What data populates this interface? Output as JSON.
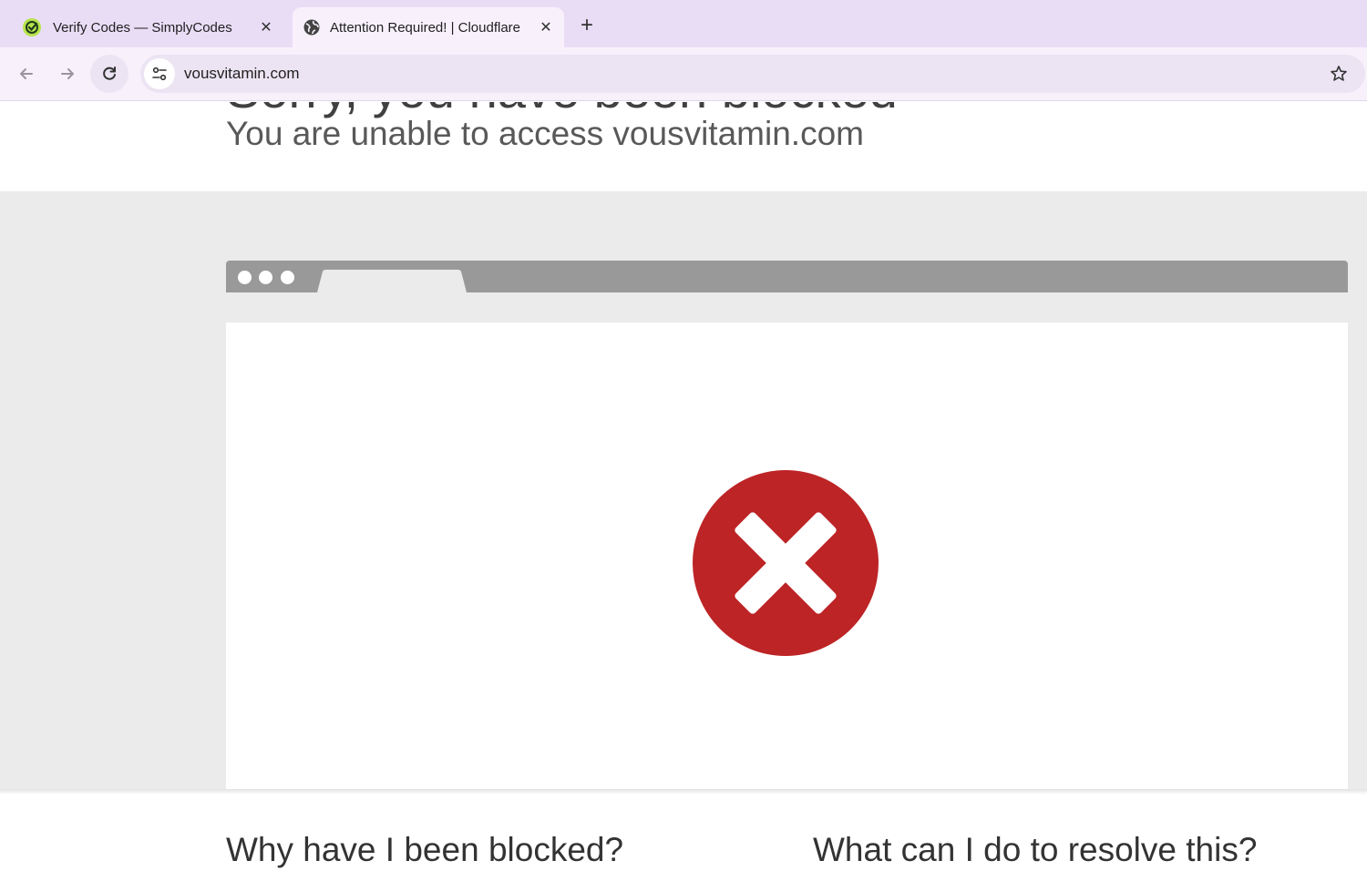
{
  "browser": {
    "tabs": [
      {
        "title": "Verify Codes — SimplyCodes",
        "icon": "simplycodes-favicon",
        "active": false
      },
      {
        "title": "Attention Required! | Cloudflare",
        "icon": "globe-icon",
        "active": true
      }
    ],
    "new_tab_glyph": "+",
    "close_glyph": "✕",
    "address_bar": {
      "url": "vousvitamin.com"
    }
  },
  "page": {
    "heading_clipped": "Sorry, you have been blocked",
    "subheading": "You are unable to access vousvitamin.com",
    "why_heading": "Why have I been blocked?",
    "resolve_heading": "What can I do to resolve this?"
  },
  "colors": {
    "tabstrip": "#e9ddf6",
    "toolbar": "#f8f1fc",
    "error_red": "#bd2426",
    "window_bar": "#999999",
    "band": "#ebebeb"
  }
}
